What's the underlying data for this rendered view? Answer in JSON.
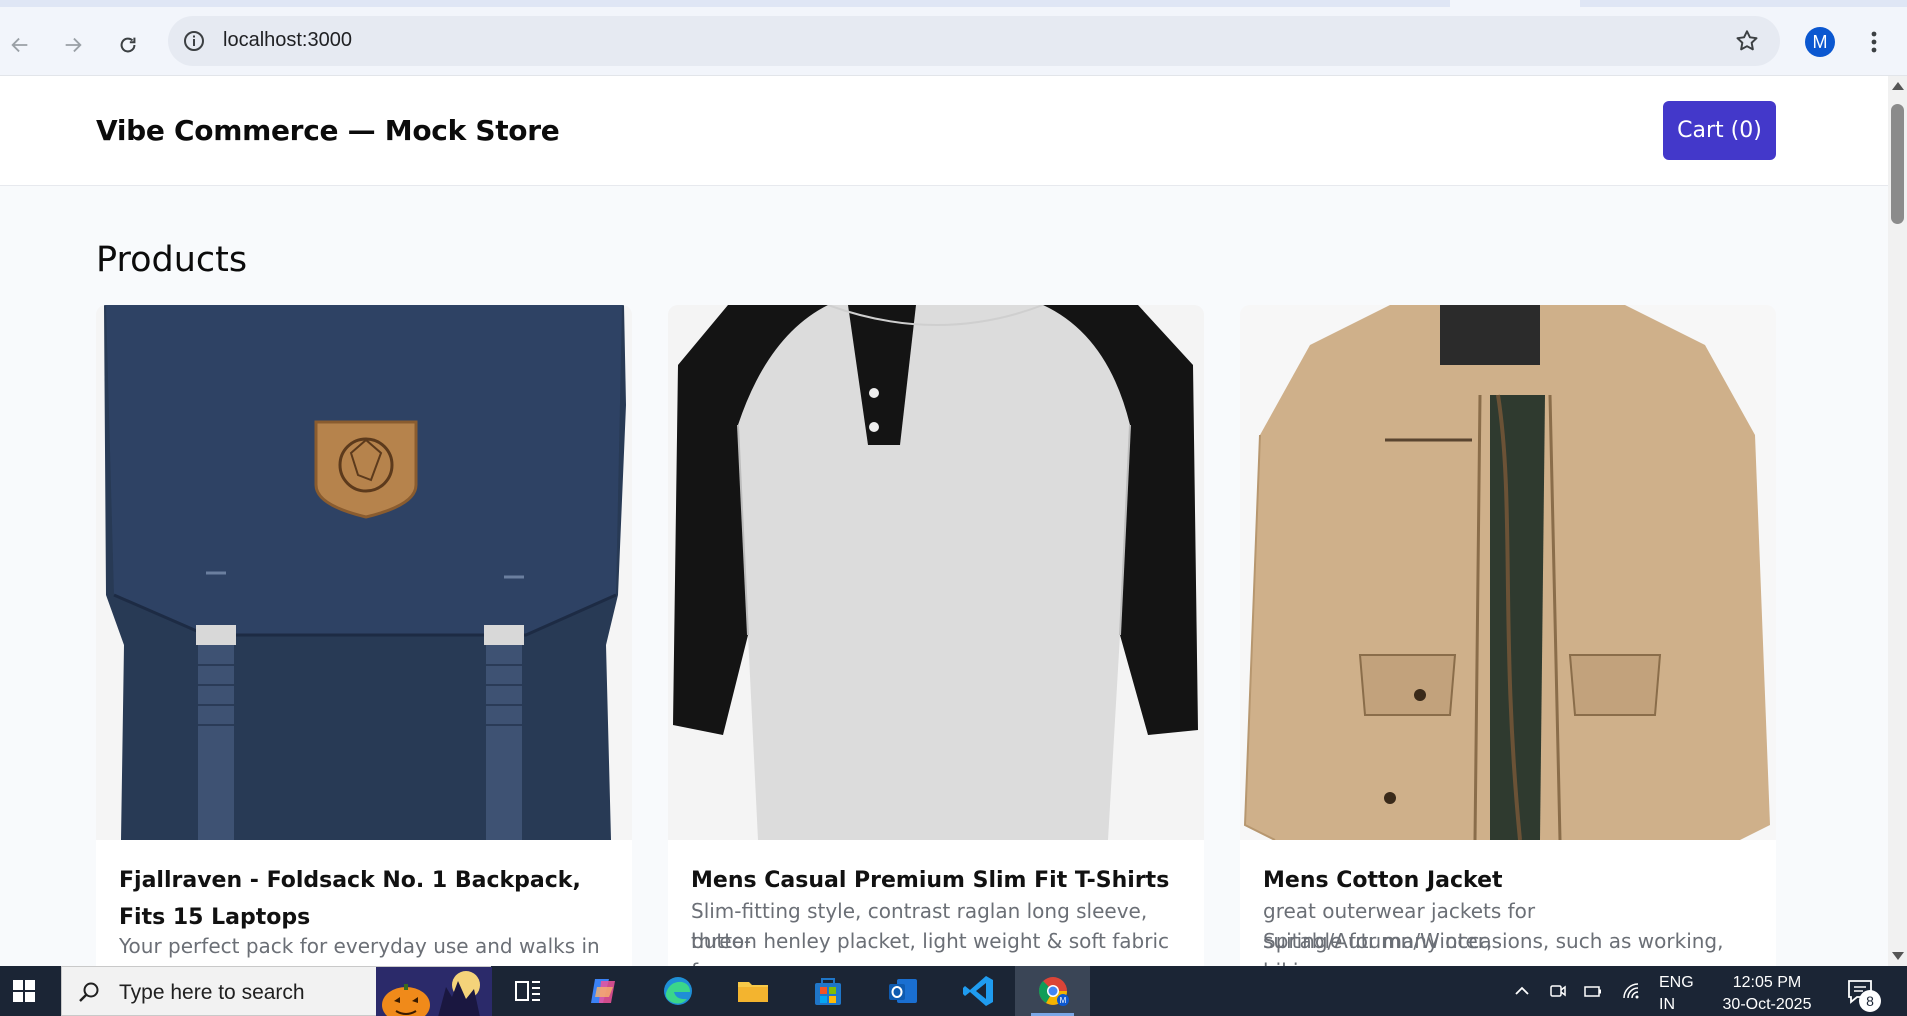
{
  "browser": {
    "url": "localhost:3000",
    "profile_initial": "M"
  },
  "header": {
    "brand": "Vibe Commerce — Mock Store",
    "cart_label": "Cart (0)"
  },
  "main": {
    "section_title": "Products",
    "products": [
      {
        "name": "Fjallraven - Foldsack No. 1 Backpack, Fits 15 Laptops",
        "description": "Your perfect pack for everyday use and walks in the"
      },
      {
        "name": "Mens Casual Premium Slim Fit T-Shirts",
        "description_line1": "Slim-fitting style, contrast raglan long sleeve, three-",
        "description_line2": "button henley placket, light weight & soft fabric fo..."
      },
      {
        "name": "Mens Cotton Jacket",
        "description_line1": "great outerwear jackets for Spring/Autumn/Winter,",
        "description_line2": "suitable for many occasions, such as working, hikin..."
      }
    ]
  },
  "taskbar": {
    "search_placeholder": "Type here to search",
    "lang_line1": "ENG",
    "lang_line2": "IN",
    "time": "12:05 PM",
    "date": "30-Oct-2025",
    "notification_count": "8"
  },
  "colors": {
    "accent": "#4338ca",
    "page_bg": "#f8fafc",
    "taskbar_bg": "#1b2535"
  }
}
